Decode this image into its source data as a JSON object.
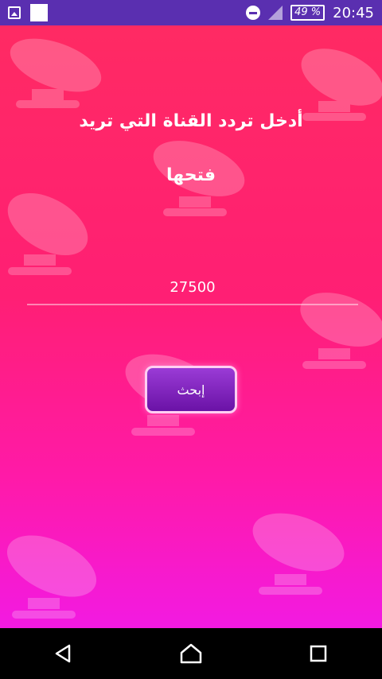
{
  "status_bar": {
    "battery": "49 %",
    "time": "20:45",
    "icons": [
      "image-icon",
      "white-square-icon",
      "do-not-disturb-icon",
      "signal-icon",
      "battery-icon"
    ]
  },
  "screen": {
    "prompt_line1": "أدخل تردد القناة التي تريد",
    "prompt_line2": "فتحها",
    "frequency_value": "27500",
    "search_label": "إبحث"
  },
  "nav_bar": {
    "icons": [
      "back-icon",
      "home-icon",
      "recents-icon"
    ]
  },
  "colors": {
    "status_bar": "#5a2fb0",
    "background_top": "#ff2a63",
    "background_bottom": "#f21ae2",
    "button": "#7a1fbf"
  }
}
